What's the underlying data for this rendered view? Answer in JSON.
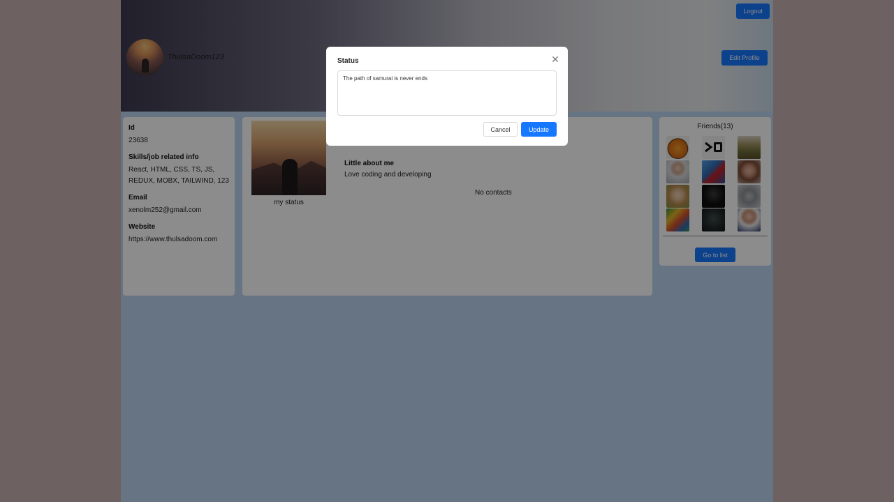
{
  "header": {
    "username": "ThulsaDoom123",
    "logout_label": "Logout",
    "edit_profile_label": "Edit Profile"
  },
  "info": {
    "id_label": "Id",
    "id_value": "23638",
    "skills_label": "Skills/job related info",
    "skills_value": "React, HTML, CSS, TS, JS, REDUX, MOBX, TAILWIND, 123",
    "email_label": "Email",
    "email_value": "xenolm252@gmail.com",
    "website_label": "Website",
    "website_value": "https://www.thulsadoom.com"
  },
  "main": {
    "status_caption": "my status",
    "about_title": "Little about me",
    "about_text": "Love coding and developing",
    "no_contacts": "No contacts"
  },
  "friends": {
    "title": "Friends(13)",
    "goto_label": "Go to list",
    "avatars": [
      "pumpkin-avatar",
      "xq-logo-avatar",
      "cat-grass-avatar",
      "man-avatar",
      "spiderman-avatar",
      "woman-avatar",
      "blond-man-avatar",
      "dark-avatar",
      "cat-avatar",
      "colorful-avatar",
      "helmet-avatar",
      "bald-man-avatar"
    ]
  },
  "modal": {
    "title": "Status",
    "textarea_value": "The path of samurai is never ends",
    "cancel_label": "Cancel",
    "update_label": "Update",
    "close_icon": "close-icon"
  },
  "colors": {
    "primary": "#1677ff",
    "page_bg": "#bcd3ee",
    "outer_bg": "#c6b1b1"
  }
}
